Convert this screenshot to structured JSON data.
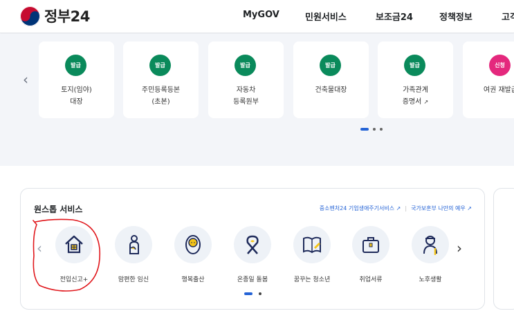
{
  "header": {
    "logo_text": "정부24",
    "nav": [
      "MyGOV",
      "민원서비스",
      "보조금24",
      "정책정보",
      "고객"
    ]
  },
  "top_cards": [
    {
      "badge": "발급",
      "label": "토지(임야)\n대장",
      "badge_color": "#0a8a5b"
    },
    {
      "badge": "발급",
      "label": "주민등록등본\n(초본)",
      "badge_color": "#0a8a5b"
    },
    {
      "badge": "발급",
      "label": "자동차\n등록원부",
      "badge_color": "#0a8a5b"
    },
    {
      "badge": "발급",
      "label": "건축물대장",
      "badge_color": "#0a8a5b"
    },
    {
      "badge": "발급",
      "label": "가족관계\n증명서",
      "badge_color": "#0a8a5b"
    },
    {
      "badge": "신청",
      "label": "여권 재발급",
      "badge_color": "#e4287d"
    }
  ],
  "oneStop": {
    "title": "원스톱 서비스",
    "link1": "중소벤처24 기업생애주기서비스",
    "link2": "국가보훈부 나만의 예우",
    "items": [
      {
        "label": "전입신고+",
        "icon": "house-icon"
      },
      {
        "label": "맘편한 임신",
        "icon": "pregnancy-icon"
      },
      {
        "label": "행복출산",
        "icon": "baby-icon"
      },
      {
        "label": "온종일 돌봄",
        "icon": "ribbon-icon"
      },
      {
        "label": "꿈꾸는 청소년",
        "icon": "book-icon"
      },
      {
        "label": "취업서류",
        "icon": "briefcase-icon"
      },
      {
        "label": "노후생활",
        "icon": "elderly-icon"
      }
    ]
  },
  "colors": {
    "primary": "#2463d6",
    "green_badge": "#0a8a5b",
    "pink_badge": "#e4287d",
    "annotation": "#e0161b"
  }
}
